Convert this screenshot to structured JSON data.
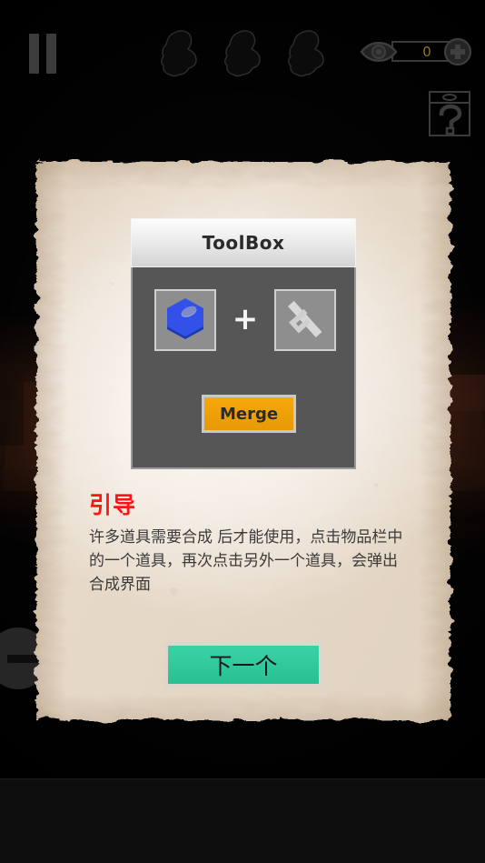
{
  "hud": {
    "pause_name": "pause-button",
    "characters": [
      {
        "name": "character-slot-1"
      },
      {
        "name": "character-slot-2"
      },
      {
        "name": "character-slot-3"
      }
    ],
    "eye_counter": {
      "value": "0",
      "icon": "eye-icon",
      "add_icon": "plus-circle-icon"
    },
    "help_icon": "help-question-icon",
    "minus_icon": "minus-circle-icon"
  },
  "toolbox": {
    "title": "ToolBox",
    "slots": [
      {
        "item": "blue-hex-nut",
        "color": "#2f4fd8"
      },
      {
        "item": "gray-rake-tool",
        "color": "#d2d2d2"
      }
    ],
    "separator": "+",
    "merge_label": "Merge",
    "merge_color": "#efa007"
  },
  "guide": {
    "title": "引导",
    "body": "许多道具需要合成 后才能使用，点击物品栏中的一个道具，再次点击另外一个道具，会弹出合成界面",
    "title_color": "#fb1616"
  },
  "next_button": {
    "label": "下一个",
    "color": "#2fc99b"
  }
}
